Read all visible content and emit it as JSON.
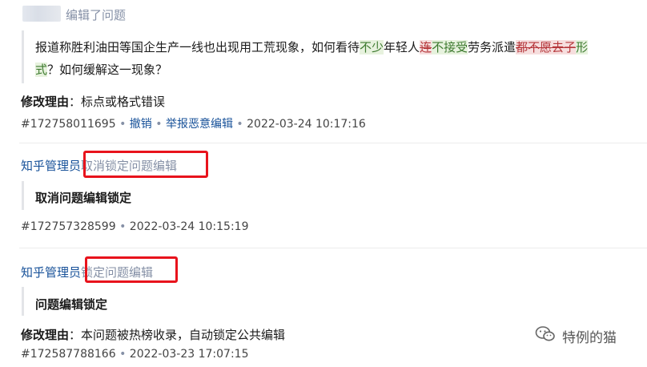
{
  "entry1": {
    "action": "编辑了问题",
    "title_segments": [
      {
        "text": "报道称胜利油田等国企生产一线也出现用工荒现象，如何看待",
        "kind": "plain"
      },
      {
        "text": "不少",
        "kind": "added"
      },
      {
        "text": "年轻人",
        "kind": "plain"
      },
      {
        "text": "连",
        "kind": "removed"
      },
      {
        "text": "不接受",
        "kind": "added"
      },
      {
        "text": "劳务派遣",
        "kind": "plain"
      },
      {
        "text": "都不愿去子",
        "kind": "removed"
      },
      {
        "text": "形",
        "kind": "added"
      }
    ],
    "title_line2_segments": [
      {
        "text": "式",
        "kind": "added"
      },
      {
        "text": "？如何缓解这一现象？",
        "kind": "plain"
      }
    ],
    "reason_label": "修改理由",
    "reason_sep": "：",
    "reason_text": "标点或格式错误",
    "id": "#172758011695",
    "undo": "撤销",
    "report": "举报恶意编辑",
    "time": "2022-03-24 10:17:16",
    "dot": "•"
  },
  "entry2": {
    "user": "知乎管理员",
    "action": "取消锁定问题编辑",
    "content": "取消问题编辑锁定",
    "id": "#172757328599",
    "time": "2022-03-24 10:15:19",
    "dot": "•"
  },
  "entry3": {
    "user": "知乎管理员",
    "action": "锁定问题编辑",
    "content": "问题编辑锁定",
    "reason_label": "修改理由",
    "reason_sep": "：",
    "reason_text": "本问题被热榜收录，自动锁定公共编辑",
    "id": "#172587788166",
    "time": "2022-03-23 17:07:15",
    "dot": "•"
  },
  "watermark": {
    "text": "特例的猫",
    "icon": "wechat-icon"
  },
  "colors": {
    "link": "#175199",
    "gray": "#8590a6",
    "added_text": "#3d7a2f",
    "added_bg": "#e7f2de",
    "removed_text": "#b5363a",
    "removed_bg": "#f6dede",
    "highlight_box": "#e8131c"
  }
}
